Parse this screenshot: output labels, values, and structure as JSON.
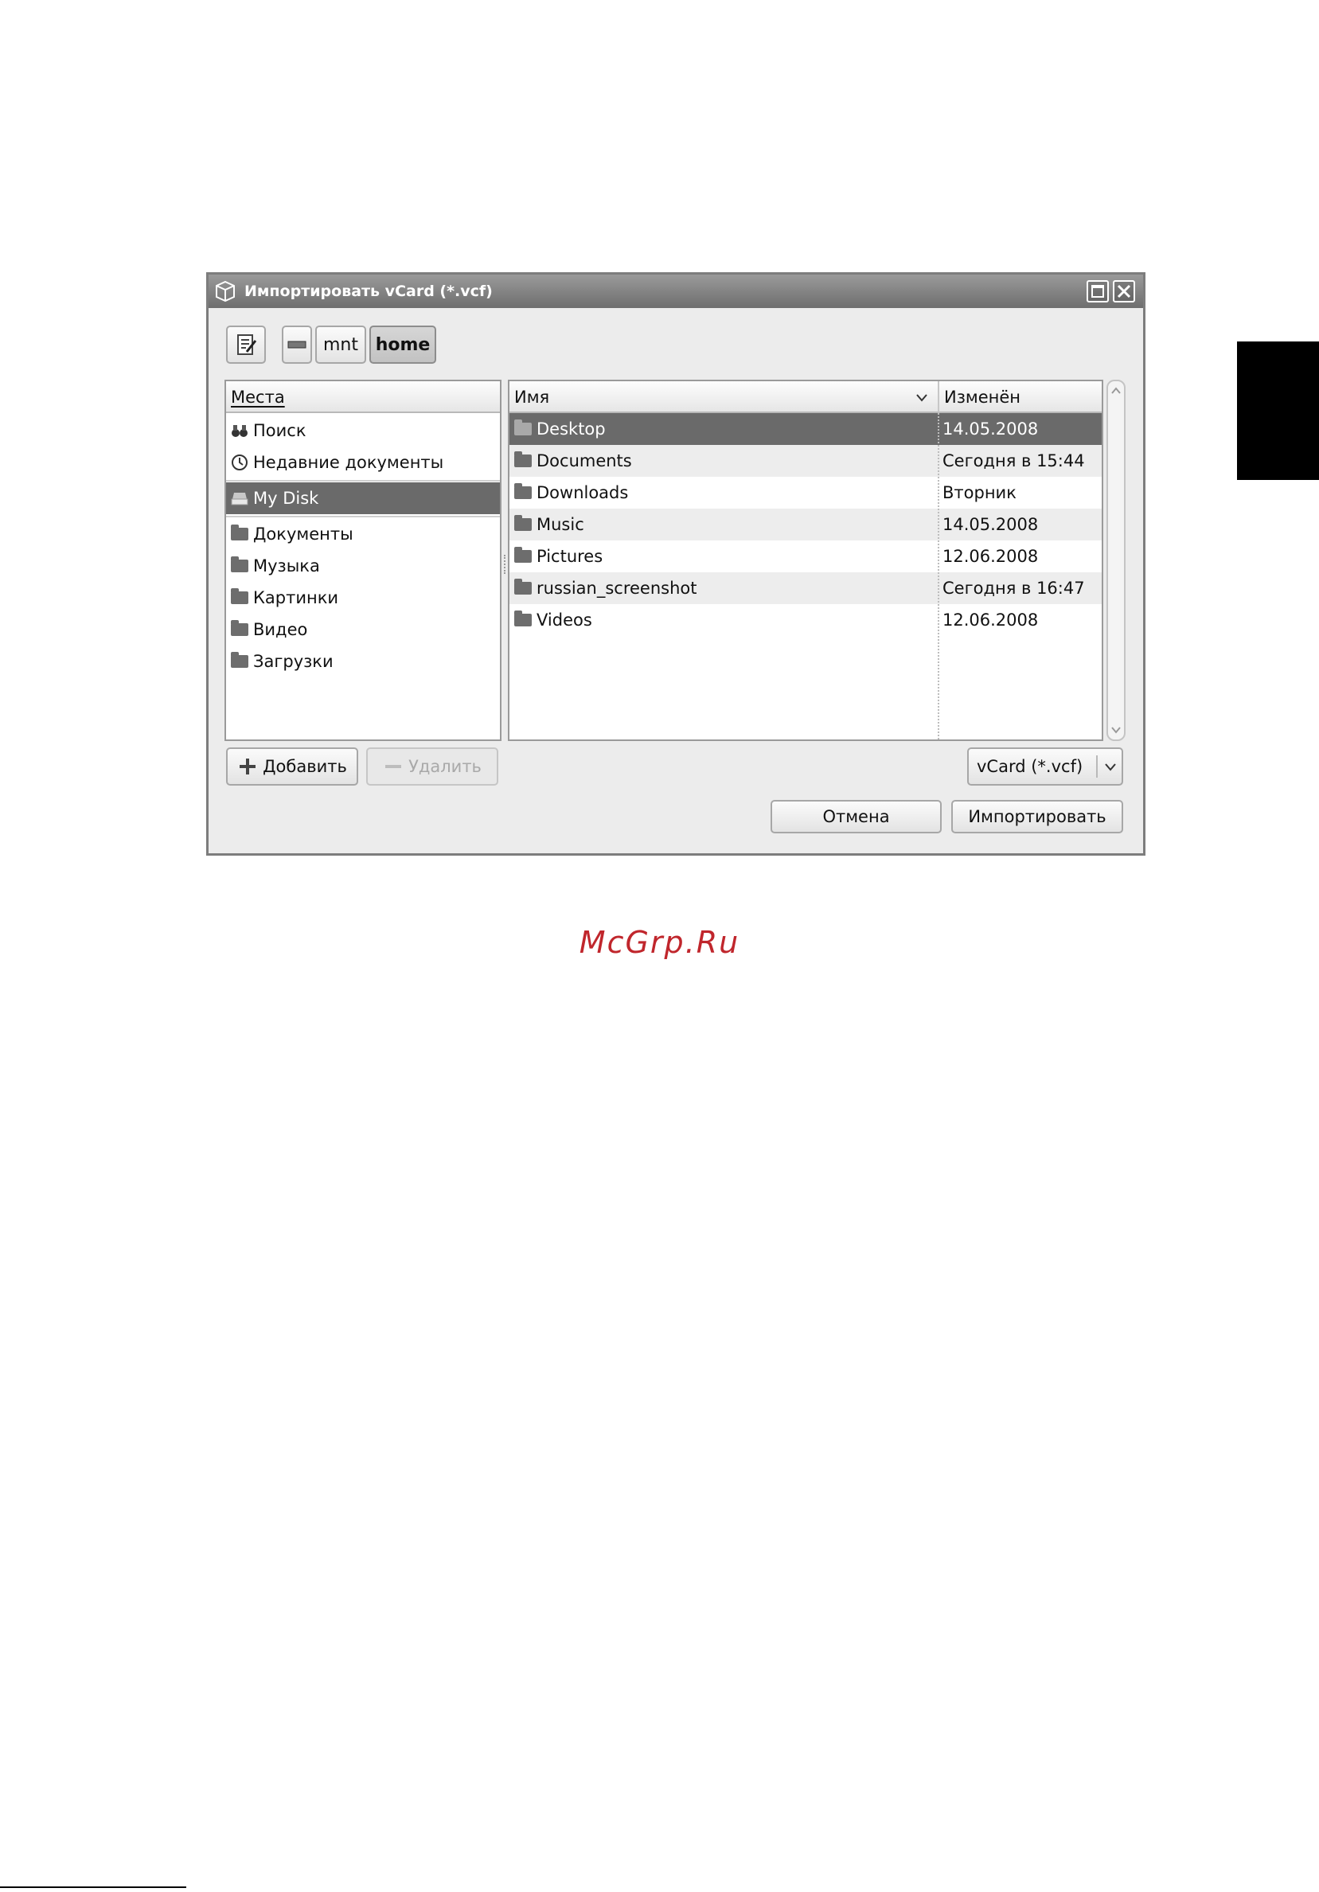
{
  "dialog": {
    "title": "Импортировать vCard (*.vcf)",
    "path": [
      "mnt",
      "home"
    ],
    "places": {
      "header": "Места",
      "items": [
        "Поиск",
        "Недавние документы",
        "My Disk",
        "Документы",
        "Музыка",
        "Картинки",
        "Видео",
        "Загрузки"
      ]
    },
    "files": {
      "header_name": "Имя",
      "header_modified": "Изменён",
      "rows": [
        {
          "name": "Desktop",
          "modified": "14.05.2008"
        },
        {
          "name": "Documents",
          "modified": "Сегодня в 15:44"
        },
        {
          "name": "Downloads",
          "modified": "Вторник"
        },
        {
          "name": "Music",
          "modified": "14.05.2008"
        },
        {
          "name": "Pictures",
          "modified": "12.06.2008"
        },
        {
          "name": "russian_screenshot",
          "modified": "Сегодня в 16:47"
        },
        {
          "name": "Videos",
          "modified": "12.06.2008"
        }
      ]
    },
    "add_label": "Добавить",
    "remove_label": "Удалить",
    "filter": "vCard (*.vcf)",
    "cancel_label": "Отмена",
    "import_label": "Импортировать"
  },
  "watermark": "McGrp.Ru",
  "colors": {
    "selection": "#6a6a6a",
    "watermark": "#c0262c"
  }
}
